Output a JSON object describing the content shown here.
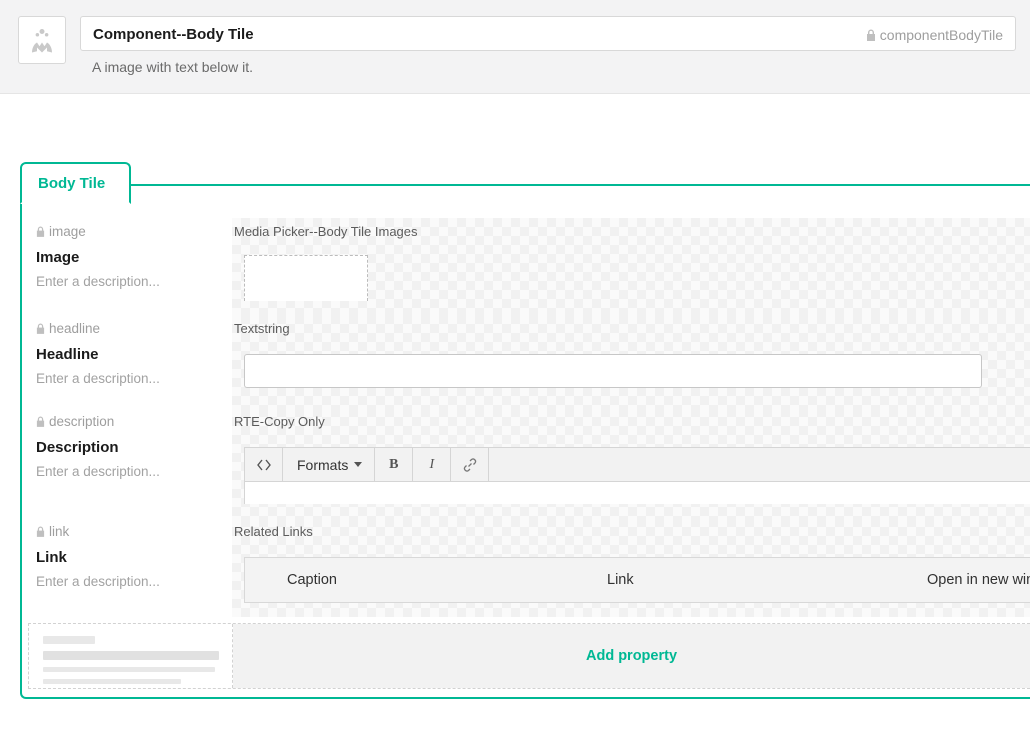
{
  "header": {
    "title": "Component--Body Tile",
    "alias": "componentBodyTile",
    "description": "A image with text below it."
  },
  "tab": {
    "label": "Body Tile"
  },
  "properties": [
    {
      "alias": "image",
      "name": "Image",
      "desc_placeholder": "Enter a description...",
      "editor_label": "Media Picker--Body Tile Images",
      "kind": "media"
    },
    {
      "alias": "headline",
      "name": "Headline",
      "desc_placeholder": "Enter a description...",
      "editor_label": "Textstring",
      "kind": "textstring"
    },
    {
      "alias": "description",
      "name": "Description",
      "desc_placeholder": "Enter a description...",
      "editor_label": "RTE-Copy Only",
      "kind": "rte"
    },
    {
      "alias": "link",
      "name": "Link",
      "desc_placeholder": "Enter a description...",
      "editor_label": "Related Links",
      "kind": "relatedlinks"
    }
  ],
  "rte": {
    "formats_label": "Formats",
    "bold_glyph": "B",
    "italic_glyph": "I"
  },
  "related_links": {
    "col_caption": "Caption",
    "col_link": "Link",
    "col_open": "Open in new win"
  },
  "footer": {
    "add_property_label": "Add property"
  }
}
